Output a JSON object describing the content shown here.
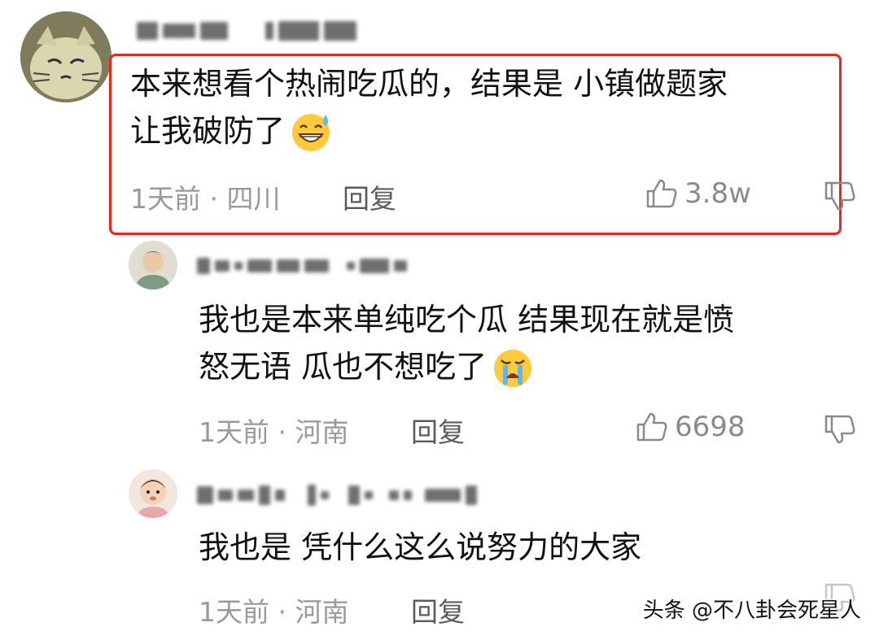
{
  "comments": [
    {
      "text_line1": "本来想看个热闹吃瓜的，结果是 小镇做题家",
      "text_line2": "让我破防了",
      "emoji": "grinning-sweat-emoji",
      "time_location": "1天前 · 四川",
      "reply_label": "回复",
      "likes": "3.8w",
      "highlighted": true
    },
    {
      "text_line1": "我也是本来单纯吃个瓜 结果现在就是愤",
      "text_line2": "怒无语 瓜也不想吃了",
      "emoji": "loudly-crying-emoji",
      "time_location": "1天前 · 河南",
      "reply_label": "回复",
      "likes": "6698"
    },
    {
      "text_line1": "我也是 凭什么这么说努力的大家",
      "time_location": "1天前 · 河南",
      "reply_label": "回复"
    }
  ],
  "watermark": "头条 @不八卦会死星人",
  "colors": {
    "highlight_border": "#e8261c",
    "meta_gray": "#9a9a9a"
  },
  "icons": [
    "thumbs-up-icon",
    "thumbs-down-icon"
  ]
}
